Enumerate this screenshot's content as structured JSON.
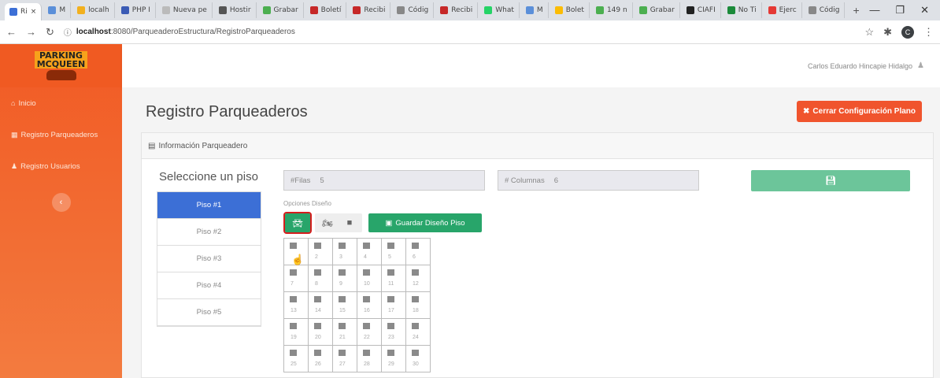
{
  "browser": {
    "tabs": [
      {
        "label": "Ri",
        "color": "#3c6fd6"
      },
      {
        "label": "M",
        "color": "#5b8fd9"
      },
      {
        "label": "localh",
        "color": "#f2b01e"
      },
      {
        "label": "PHP I",
        "color": "#3b5bb5"
      },
      {
        "label": "Nueva pe",
        "color": "#bbbbbb"
      },
      {
        "label": "Hostir",
        "color": "#555555"
      },
      {
        "label": "Grabar",
        "color": "#4caf50"
      },
      {
        "label": "Boletí",
        "color": "#c62828"
      },
      {
        "label": "Recibi",
        "color": "#c62828"
      },
      {
        "label": "Códig",
        "color": "#888888"
      },
      {
        "label": "Recibi",
        "color": "#c62828"
      },
      {
        "label": "What",
        "color": "#25d366"
      },
      {
        "label": "M",
        "color": "#5b8fd9"
      },
      {
        "label": "Bolet",
        "color": "#fbbc04"
      },
      {
        "label": "149 n",
        "color": "#4caf50"
      },
      {
        "label": "Grabar",
        "color": "#4caf50"
      },
      {
        "label": "CIAFI",
        "color": "#222222"
      },
      {
        "label": "No Ti",
        "color": "#1b8a3a"
      },
      {
        "label": "Ejerc",
        "color": "#e53935"
      },
      {
        "label": "Códig",
        "color": "#888888"
      }
    ],
    "url_host": "localhost",
    "url_path": ":8080/ParqueaderoEstructura/RegistroParqueaderos",
    "profile_initial": "C"
  },
  "sidebar": {
    "logo_line1": "PARKING",
    "logo_line2": "MCQUEEN",
    "items": [
      {
        "label": "Inicio",
        "icon": "home-icon"
      },
      {
        "label": "Registro Parqueaderos",
        "icon": "parking-icon"
      },
      {
        "label": "Registro Usuarios",
        "icon": "user-icon"
      }
    ]
  },
  "header": {
    "user_name": "Carlos Eduardo Hincapie Hidalgo"
  },
  "page": {
    "title": "Registro Parqueaderos",
    "close_button": "Cerrar Configuración Plano",
    "panel_heading": "Información Parqueadero",
    "floor_title": "Seleccione un piso",
    "floors": [
      "Piso #1",
      "Piso #2",
      "Piso #3",
      "Piso #4",
      "Piso #5"
    ],
    "active_floor": 0,
    "rows_label": "#Filas",
    "rows_value": "5",
    "cols_label": "# Columnas",
    "cols_value": "6",
    "design_options_label": "Opciones Diseño",
    "save_floor_button": "Guardar Diseño Piso",
    "grid_cells": [
      "",
      "2",
      "3",
      "4",
      "5",
      "6",
      "7",
      "8",
      "9",
      "10",
      "11",
      "12",
      "13",
      "14",
      "15",
      "16",
      "17",
      "18",
      "19",
      "20",
      "21",
      "22",
      "23",
      "24",
      "25",
      "26",
      "27",
      "28",
      "29",
      "30"
    ]
  },
  "colors": {
    "sidebar_orange": "#f15a24",
    "primary_blue": "#3c6fd6",
    "success_green": "#28a56a",
    "danger_red": "#f0542d"
  }
}
